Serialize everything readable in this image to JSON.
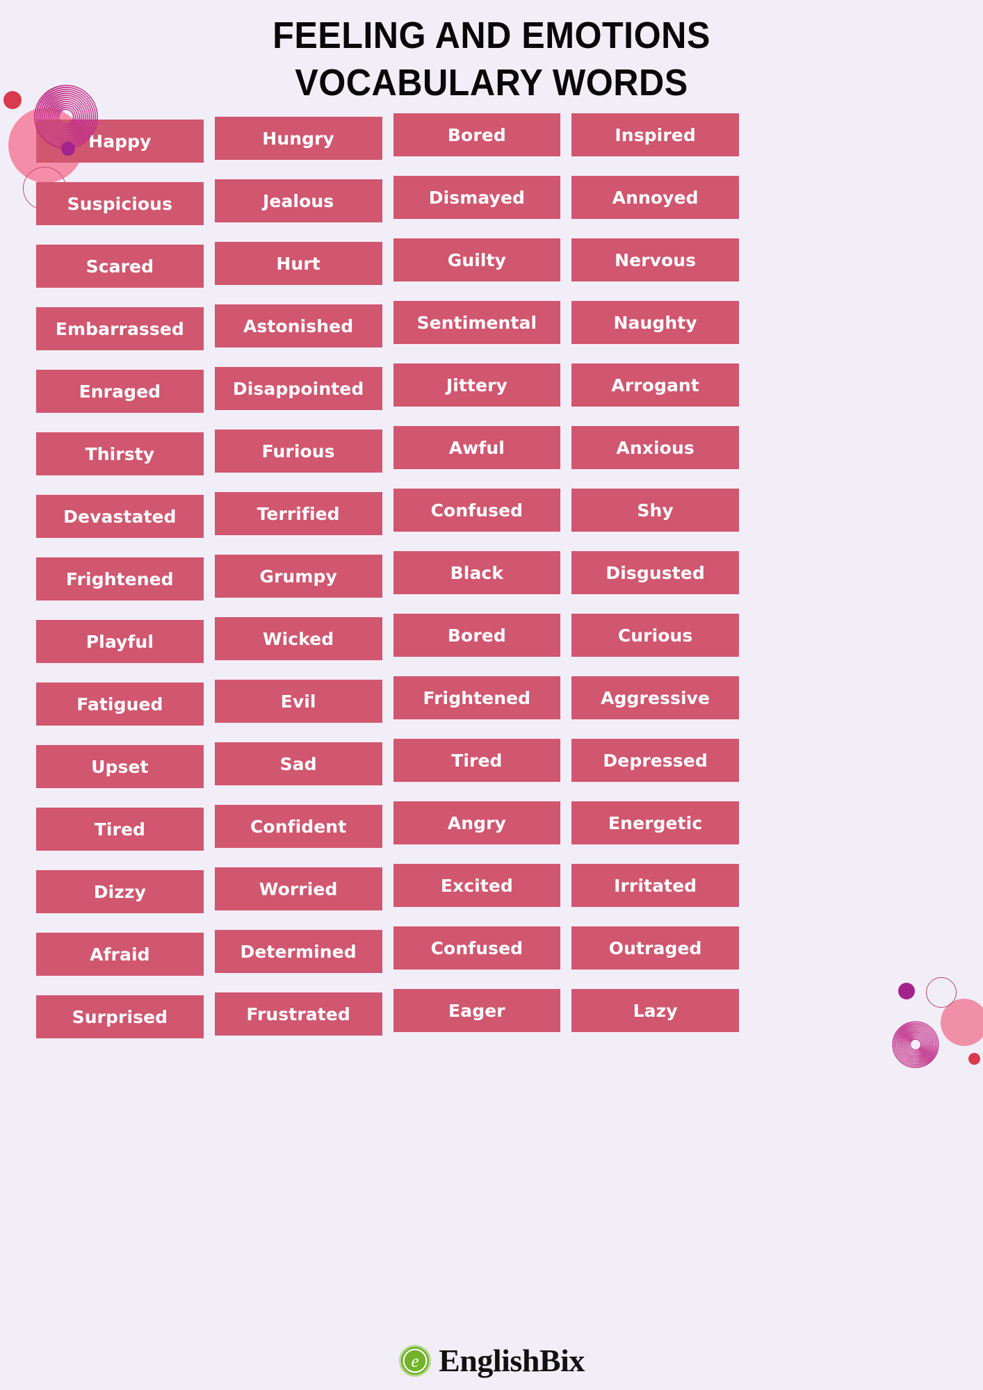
{
  "title": {
    "line1": "FEELING AND EMOTIONS",
    "line2": "VOCABULARY WORDS"
  },
  "colors": {
    "background": "#f2eef8",
    "cell_fill": "#d1566f",
    "cell_text": "#ffffff",
    "title_text": "#080808",
    "accent_pink": "#f47f9c",
    "accent_red_dot": "#d93a4e",
    "accent_purple_dot": "#a3238e",
    "spiral_stroke": "#b8247e",
    "logo_green": "#72b32a"
  },
  "grid": {
    "columns": 4,
    "rows": 15,
    "words": [
      "Happy",
      "Hungry",
      "Bored",
      "Inspired",
      "Suspicious",
      "Jealous",
      "Dismayed",
      "Annoyed",
      "Scared",
      "Hurt",
      "Guilty",
      "Nervous",
      "Embarrassed",
      "Astonished",
      "Sentimental",
      "Naughty",
      "Enraged",
      "Disappointed",
      "Jittery",
      "Arrogant",
      "Thirsty",
      "Furious",
      "Awful",
      "Anxious",
      "Devastated",
      "Terrified",
      "Confused",
      "Shy",
      "Frightened",
      "Grumpy",
      "Black",
      "Disgusted",
      "Playful",
      "Wicked",
      "Bored",
      "Curious",
      "Fatigued",
      "Evil",
      "Frightened",
      "Aggressive",
      "Upset",
      "Sad",
      "Tired",
      "Depressed",
      "Tired",
      "Confident",
      "Angry",
      "Energetic",
      "Dizzy",
      "Worried",
      "Excited",
      "Irritated",
      "Afraid",
      "Determined",
      "Confused",
      "Outraged",
      "Surprised",
      "Frustrated",
      "Eager",
      "Lazy"
    ],
    "offsets": [
      "down",
      "",
      "up",
      "up",
      "down",
      "",
      "up",
      "up",
      "down",
      "",
      "up",
      "up",
      "down",
      "",
      "up",
      "up",
      "down",
      "",
      "up",
      "up",
      "down",
      "",
      "up",
      "up",
      "down",
      "",
      "up",
      "up",
      "down",
      "",
      "up",
      "up",
      "down",
      "",
      "up",
      "up",
      "down",
      "",
      "up",
      "up",
      "down",
      "",
      "up",
      "up",
      "down",
      "",
      "up",
      "up",
      "down",
      "",
      "up",
      "up",
      "down",
      "",
      "up",
      "up",
      "down",
      "",
      "up",
      "up"
    ]
  },
  "footer": {
    "logo_letter": "e",
    "brand": "EnglishBix"
  }
}
